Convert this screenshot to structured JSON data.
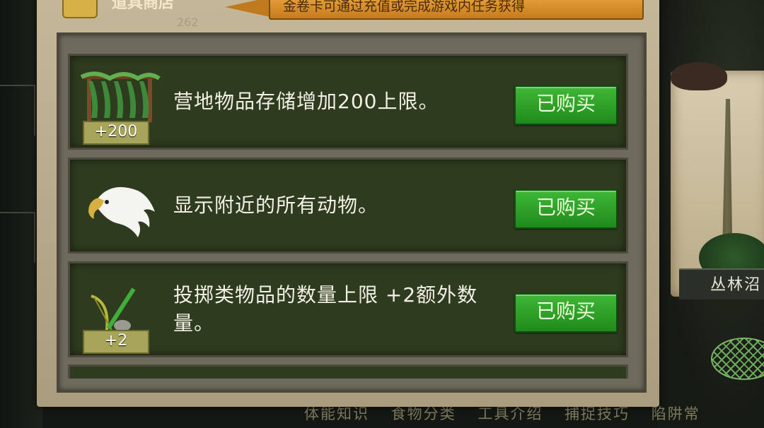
{
  "header": {
    "shop_title": "道具商店",
    "count": "262",
    "notice": "金卷卡可通过充值或完成游戏内任务获得"
  },
  "items": [
    {
      "desc": "营地物品存储增加200上限。",
      "badge": "+200",
      "icon": "camp-shelter-icon",
      "status": "已购买"
    },
    {
      "desc": "显示附近的所有动物。",
      "badge": "",
      "icon": "eagle-icon",
      "status": "已购买"
    },
    {
      "desc": "投掷类物品的数量上限 +2额外数量。",
      "badge": "+2",
      "icon": "bow-and-stone-icon",
      "status": "已购买"
    }
  ],
  "side_panel": {
    "label": "丛林沼"
  },
  "bottom_tabs": [
    "体能知识",
    "食物分类",
    "工具介绍",
    "捕捉技巧",
    "陷阱常"
  ],
  "colors": {
    "row_bg": "#2f3b1e",
    "buy_button": "#2ea62a",
    "notice_bg": "#e6a23c",
    "panel_frame": "#c4b898"
  }
}
